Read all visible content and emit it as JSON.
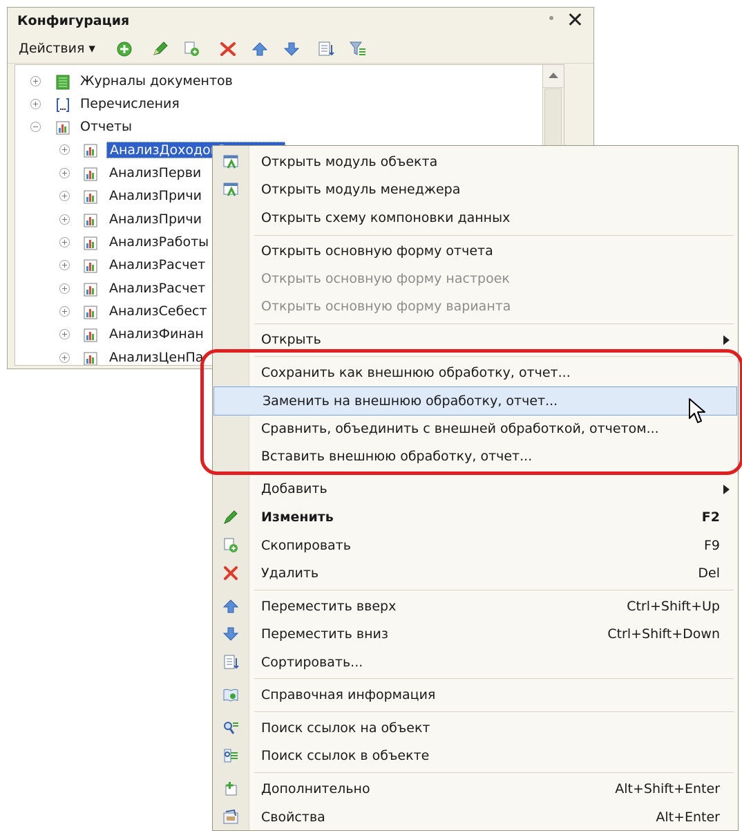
{
  "window": {
    "title": "Конфигурация"
  },
  "toolbar": {
    "actions_label": "Действия ▾"
  },
  "tree": {
    "items": [
      {
        "label": "Журналы документов"
      },
      {
        "label": "Перечисления"
      },
      {
        "label": "Отчеты"
      },
      {
        "label": "АнализДоходовРасходов"
      },
      {
        "label": "АнализПерви"
      },
      {
        "label": "АнализПричи"
      },
      {
        "label": "АнализПричи"
      },
      {
        "label": "АнализРаботы"
      },
      {
        "label": "АнализРасчет"
      },
      {
        "label": "АнализРасчет"
      },
      {
        "label": "АнализСебест"
      },
      {
        "label": "АнализФинан"
      },
      {
        "label": "АнализЦенПа"
      }
    ]
  },
  "menu": {
    "items": [
      {
        "label": "Открыть модуль объекта"
      },
      {
        "label": "Открыть модуль менеджера"
      },
      {
        "label": "Открыть схему компоновки данных"
      },
      {
        "label": "Открыть основную форму отчета"
      },
      {
        "label": "Открыть основную форму настроек"
      },
      {
        "label": "Открыть основную форму варианта"
      },
      {
        "label": "Открыть"
      },
      {
        "label": "Сохранить как внешнюю обработку, отчет..."
      },
      {
        "label": "Заменить на внешнюю обработку, отчет..."
      },
      {
        "label": "Сравнить, объединить с внешней обработкой, отчетом..."
      },
      {
        "label": "Вставить внешнюю обработку, отчет..."
      },
      {
        "label": "Добавить"
      },
      {
        "label": "Изменить",
        "shortcut": "F2"
      },
      {
        "label": "Скопировать",
        "shortcut": "F9"
      },
      {
        "label": "Удалить",
        "shortcut": "Del"
      },
      {
        "label": "Переместить вверх",
        "shortcut": "Ctrl+Shift+Up"
      },
      {
        "label": "Переместить вниз",
        "shortcut": "Ctrl+Shift+Down"
      },
      {
        "label": "Сортировать..."
      },
      {
        "label": "Справочная информация"
      },
      {
        "label": "Поиск ссылок на объект"
      },
      {
        "label": "Поиск ссылок в объекте"
      },
      {
        "label": "Дополнительно",
        "shortcut": "Alt+Shift+Enter"
      },
      {
        "label": "Свойства",
        "shortcut": "Alt+Enter"
      }
    ]
  },
  "icons": {
    "toolbar": [
      "add-icon",
      "pencil-icon",
      "copy-icon",
      "delete-icon",
      "move-up-icon",
      "move-down-icon",
      "sort-icon",
      "filter-icon"
    ],
    "menu": [
      "module-icon",
      "pencil-icon",
      "copy-icon",
      "delete-icon",
      "move-up-icon",
      "move-down-icon",
      "sort-icon",
      "help-icon",
      "search-refs-icon",
      "search-in-object-icon",
      "additional-icon",
      "properties-icon"
    ]
  },
  "colors": {
    "selection": "#2f5fc8",
    "highlight_border": "#e02020",
    "menu_hover": "#dfeaf8"
  }
}
